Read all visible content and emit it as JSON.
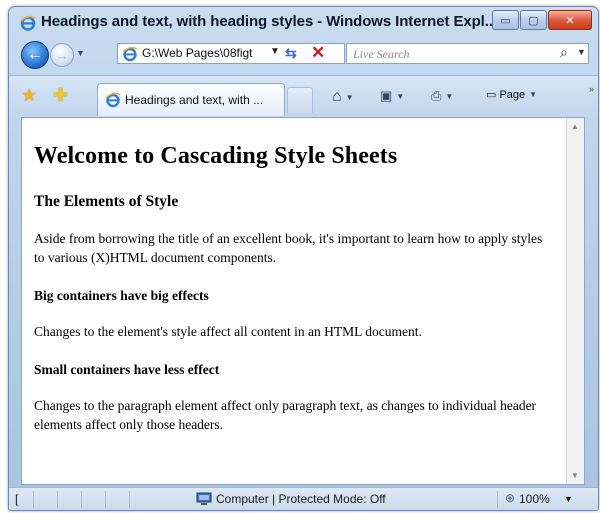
{
  "window": {
    "title": "Headings and text, with heading styles - Windows Internet Expl...",
    "minimize_label": "▭",
    "maximize_label": "▢",
    "close_label": "✕"
  },
  "navigation": {
    "address_value": "G:\\Web Pages\\08figt",
    "search_placeholder": "Live Search"
  },
  "toolbar": {
    "tab_label": "Headings and text, with ...",
    "page_menu_label": "Page"
  },
  "page": {
    "heading": "Welcome to Cascading Style Sheets",
    "subheading": "The Elements of Style",
    "intro": "Aside from borrowing the title of an excellent book, it's important to learn how to apply styles to various (X)HTML document components.",
    "section1_heading": "Big containers have big effects",
    "section1_text": "Changes to the element's style affect all content in an HTML document.",
    "section2_heading": "Small containers have less effect",
    "section2_text": "Changes to the paragraph element affect only paragraph text, as changes to individual header elements affect only those headers."
  },
  "status": {
    "left_text": "[",
    "zone_text": "Computer | Protected Mode: Off",
    "zoom_text": "100%"
  },
  "icons": {
    "app": "ie-logo-icon",
    "back": "back-arrow-icon",
    "forward": "forward-arrow-icon",
    "refresh": "refresh-icon",
    "stop": "stop-icon",
    "search": "search-icon",
    "favorites": "favorites-star-icon",
    "add_favorites": "add-favorites-icon",
    "home": "home-icon",
    "feeds": "feeds-icon",
    "print": "print-icon",
    "zone": "computer-zone-icon",
    "zoom": "zoom-icon"
  },
  "colors": {
    "frame": "#b4cce6",
    "close_button": "#dd5b3f",
    "back_button": "#1f67c4"
  }
}
